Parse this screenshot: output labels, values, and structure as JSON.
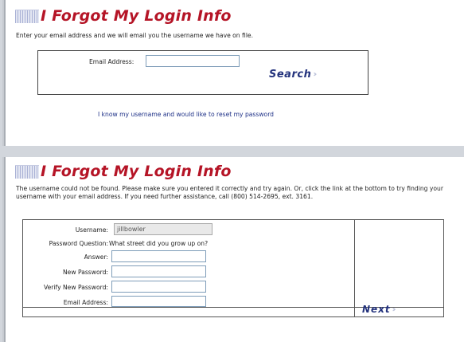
{
  "lookup": {
    "title": "I Forgot My Login Info",
    "intro": "Enter your email address and we will email you the username we have on file.",
    "email_label": "Email Address:",
    "email_value": "",
    "search_label": "Search",
    "reset_link": "I know my username and would like to reset my password"
  },
  "reset": {
    "title": "I Forgot My Login Info",
    "intro": "The username could not be found. Please make sure you entered it correctly and try again. Or, click the link at the bottom to try finding your username with your email address. If you need further assistance, call (800) 514-2695, ext. 3161.",
    "username_label": "Username:",
    "username_value": "jillbowler",
    "question_label": "Password Question:",
    "question_value": "What street did you grow up on?",
    "answer_label": "Answer:",
    "new_password_label": "New Password:",
    "verify_password_label": "Verify New Password:",
    "email_label": "Email Address:",
    "next_label": "Next"
  },
  "icons": {
    "title_icon": "striped-square-icon",
    "chevron": "double-chevron-right-icon"
  },
  "colors": {
    "title_red": "#b51426",
    "button_blue": "#24337d",
    "link_blue": "#1c2f86"
  }
}
